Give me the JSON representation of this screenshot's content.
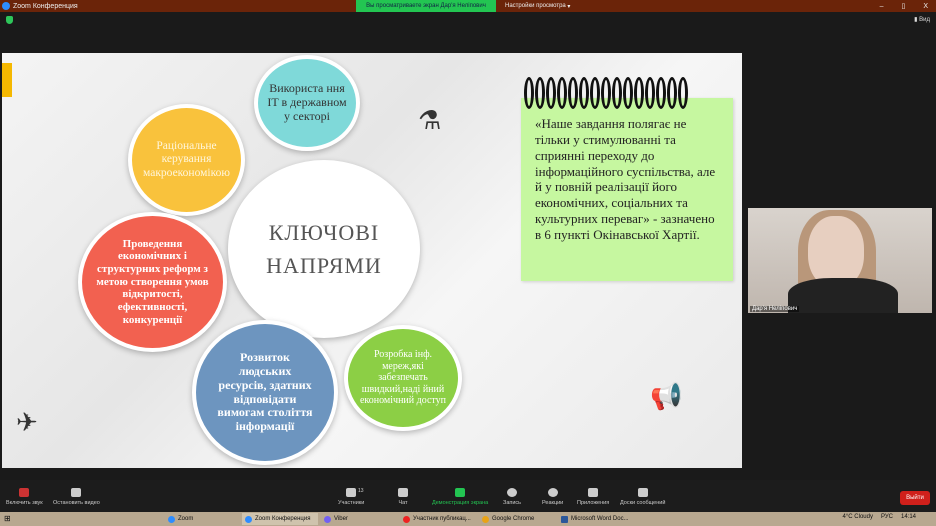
{
  "window": {
    "title": "Zoom Конференция",
    "share_banner": "Вы просматриваете экран Дар'я Неліпович",
    "view_options": "Настройки просмотра",
    "view_button": "Вид",
    "minimize": "–",
    "maximize": "▯",
    "close": "X"
  },
  "slide": {
    "center": [
      "КЛЮЧОВІ",
      "НАПРЯМИ"
    ],
    "circles": {
      "teal": "Використа ння IT в державном у секторі",
      "yellow": "Раціональне керування макроекономікою",
      "red": "Проведення економічних і структурних реформ з метою створення умов відкритості, ефективності, конкуренції",
      "blue": "Розвиток людських ресурсів, здатних відповідати вимогам століття інформації",
      "green": "Розробка інф. мереж,які забезпечать швидкий,наді йний економічний доступ"
    },
    "note": "«Наше завдання полягає не тільки у стимулюванні та сприянні переходу до інформаційного суспільства, але й у повній реалізації його економічних, соціальних та культурних переваг» - зазначено в 6 пункті Окінавської Хартії.",
    "colors": {
      "teal": "#7fd9d9",
      "yellow": "#f9c23c",
      "red": "#f26150",
      "blue": "#6d95bf",
      "green": "#8ccf45",
      "note": "#c6f7a0"
    }
  },
  "participant": {
    "name": "Дар'я Неліпович"
  },
  "controls": {
    "mute": "Включить звук",
    "video": "Остановить видео",
    "participants": "Участники",
    "participants_count": "13",
    "chat": "Чат",
    "share": "Демонстрация экрана",
    "record": "Запись",
    "reactions": "Реакции",
    "apps": "Приложения",
    "whiteboard": "Доски сообщений",
    "leave": "Выйти"
  },
  "taskbar": {
    "items": [
      "Zoom",
      "Zoom Конференция",
      "Viber",
      "Участник публикац...",
      "Google Chrome",
      "Microsoft Word Doc..."
    ],
    "weather": "4°C Cloudy",
    "lang": "РУС",
    "time": "14:14"
  }
}
